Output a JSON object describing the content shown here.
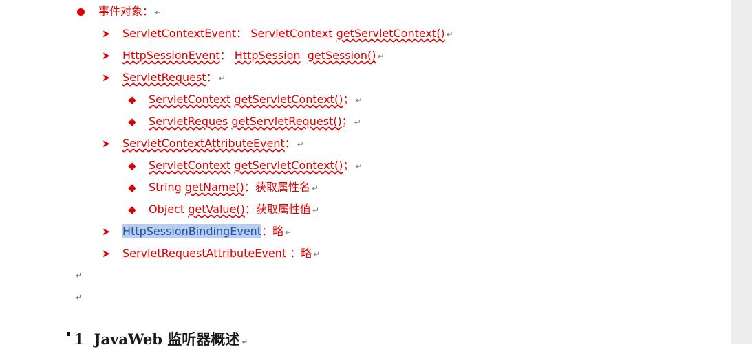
{
  "doc": {
    "title_heading": {
      "number": "1",
      "text": "JavaWeb 监听器概述"
    },
    "section_title": "事件对象：",
    "items": {
      "servlet_context_event": {
        "name": "ServletContextEvent",
        "sep": "：",
        "desc_type": "ServletContext",
        "desc_method": "getServletContext()"
      },
      "http_session_event": {
        "name": "HttpSessionEvent",
        "sep": "：",
        "desc_type": "HttpSession",
        "desc_method": "getSession()"
      },
      "servlet_request": {
        "name": "ServletRequest",
        "sep": "："
      },
      "servlet_request_sub1": {
        "type": "ServletContext",
        "method": "getServletContext()",
        "end": "；"
      },
      "servlet_request_sub2": {
        "type": "ServletReques",
        "method": "getServletRequest()",
        "end": "；"
      },
      "servlet_context_attribute_event": {
        "name": "ServletContextAttributeEvent",
        "sep": "："
      },
      "attr_sub1": {
        "type": "ServletContext",
        "method": "getServletContext()",
        "end": "；"
      },
      "attr_sub2": {
        "type": "String",
        "method": "getName()",
        "sep": "：",
        "desc": "获取属性名"
      },
      "attr_sub3": {
        "type": "Object",
        "method": "getValue()",
        "sep": "：",
        "desc": "获取属性值"
      },
      "http_session_binding_event": {
        "name": "HttpSessionBindingEvent",
        "sep": "：",
        "desc": "略"
      },
      "servlet_request_attribute_event": {
        "name": "ServletRequestAttributeEvent",
        "sep": "：",
        "desc": "略"
      }
    },
    "symbols": {
      "return_mark": "↵",
      "arrow_bullet": "➤",
      "diamond_bullet": "◆"
    }
  },
  "colors": {
    "text": "#e00000",
    "selection": "#b7cfea",
    "link": "#2b4db0",
    "gutter": "#ededed"
  }
}
